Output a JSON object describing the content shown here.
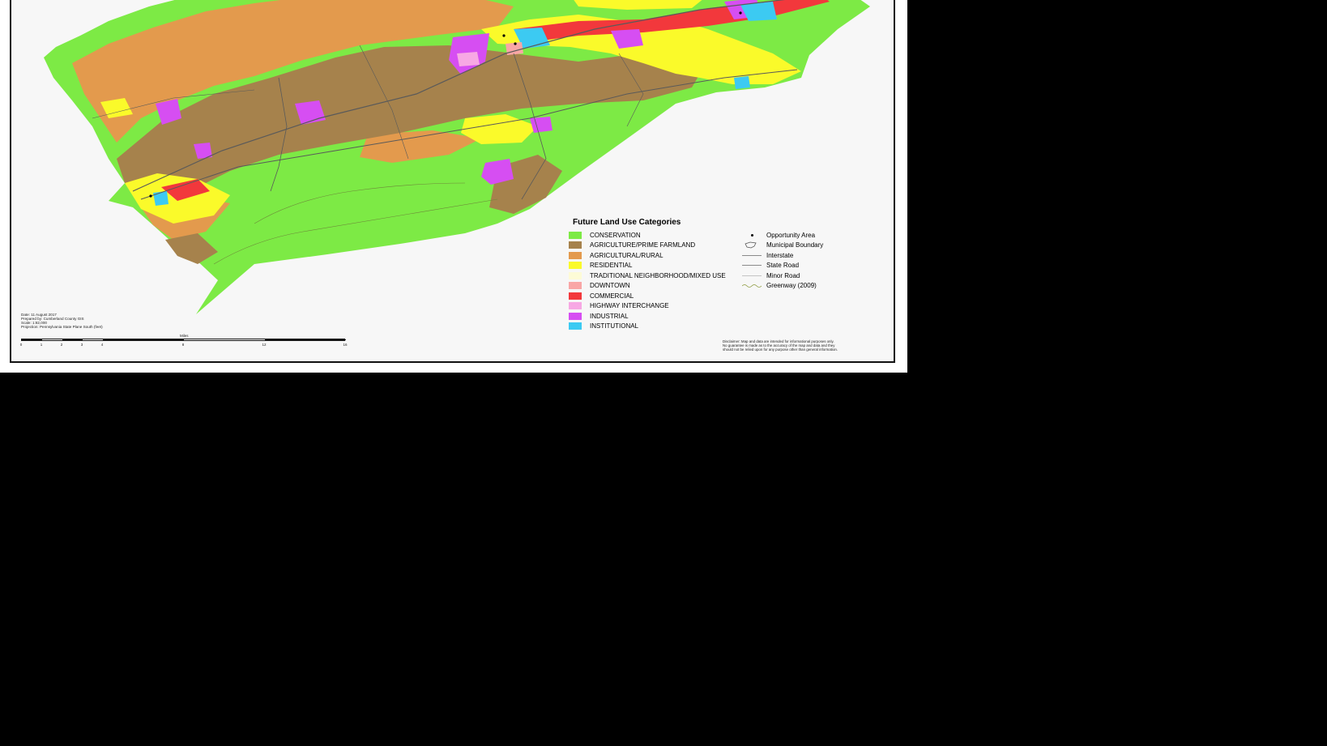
{
  "map": {
    "legend": {
      "title": "Future Land Use Categories",
      "categories": [
        {
          "label": "CONSERVATION",
          "color": "#7dea45"
        },
        {
          "label": "AGRICULTURE/PRIME FARMLAND",
          "color": "#a6824c"
        },
        {
          "label": "AGRICULTURAL/RURAL",
          "color": "#e39a4d"
        },
        {
          "label": "RESIDENTIAL",
          "color": "#fafa2a"
        },
        {
          "label": "TRADITIONAL NEIGHBORHOOD/MIXED USE",
          "color": "#fdfbd6"
        },
        {
          "label": "DOWNTOWN",
          "color": "#f9a6a6"
        },
        {
          "label": "COMMERCIAL",
          "color": "#f2383c"
        },
        {
          "label": "HIGHWAY INTERCHANGE",
          "color": "#f7a8e4"
        },
        {
          "label": "INDUSTRIAL",
          "color": "#d64ef2"
        },
        {
          "label": "INSTITUTIONAL",
          "color": "#3ccaf2"
        }
      ],
      "features": [
        {
          "label": "Opportunity Area",
          "icon": "point-icon"
        },
        {
          "label": "Municipal Boundary",
          "icon": "boundary-polygon-icon"
        },
        {
          "label": "Interstate",
          "icon": "line-icon"
        },
        {
          "label": "State Road",
          "icon": "line-icon"
        },
        {
          "label": "Minor Road",
          "icon": "thin-line-icon"
        },
        {
          "label": "Greenway (2009)",
          "icon": "wavy-line-icon"
        }
      ]
    },
    "metadata": {
      "date": "Date: 11 August 2017",
      "prepared_by": "Prepared by: Cumberland County GIS",
      "scale": "Scale: 1:82,000",
      "projection": "Projection: Pennsylvania State Plane South (feet)"
    },
    "scale_bar": {
      "title": "Miles",
      "ticks": [
        0,
        1,
        2,
        3,
        4,
        8,
        12,
        16
      ]
    },
    "disclaimer": {
      "line1": "Disclaimer: Map and data are intended for informational purposes only.",
      "line2": "No guarantee is made as to the accuracy of the map and data and they",
      "line3": "should not be relied upon for any purpose other than general information."
    }
  }
}
